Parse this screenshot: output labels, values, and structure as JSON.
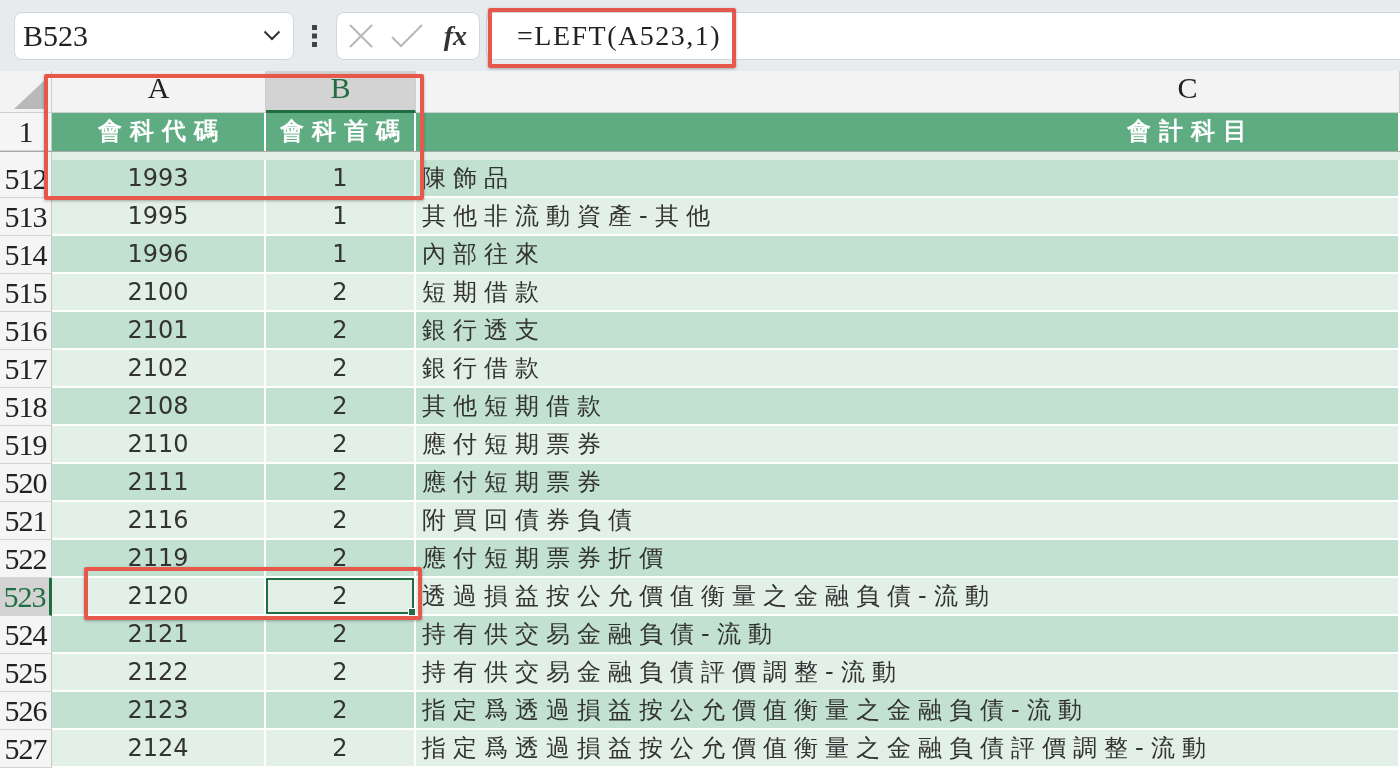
{
  "name_box": {
    "value": "B523"
  },
  "formula_bar": {
    "function_button": "fx",
    "formula": "=LEFT(A523,1)"
  },
  "columns": [
    {
      "letter": "A",
      "selected": false
    },
    {
      "letter": "B",
      "selected": true
    },
    {
      "letter": "C",
      "selected": false
    }
  ],
  "header_row": {
    "number": "1",
    "cells": [
      "會科代碼",
      "會科首碼",
      "會計科目"
    ]
  },
  "rows": [
    {
      "number": "512",
      "selected": false,
      "cells": [
        "1993",
        "1",
        "陳飾品"
      ]
    },
    {
      "number": "513",
      "selected": false,
      "cells": [
        "1995",
        "1",
        "其他非流動資產-其他"
      ]
    },
    {
      "number": "514",
      "selected": false,
      "cells": [
        "1996",
        "1",
        "內部往來"
      ]
    },
    {
      "number": "515",
      "selected": false,
      "cells": [
        "2100",
        "2",
        "短期借款"
      ]
    },
    {
      "number": "516",
      "selected": false,
      "cells": [
        "2101",
        "2",
        "銀行透支"
      ]
    },
    {
      "number": "517",
      "selected": false,
      "cells": [
        "2102",
        "2",
        "銀行借款"
      ]
    },
    {
      "number": "518",
      "selected": false,
      "cells": [
        "2108",
        "2",
        "其他短期借款"
      ]
    },
    {
      "number": "519",
      "selected": false,
      "cells": [
        "2110",
        "2",
        "應付短期票券"
      ]
    },
    {
      "number": "520",
      "selected": false,
      "cells": [
        "2111",
        "2",
        "應付短期票券"
      ]
    },
    {
      "number": "521",
      "selected": false,
      "cells": [
        "2116",
        "2",
        "附買回債券負債"
      ]
    },
    {
      "number": "522",
      "selected": false,
      "cells": [
        "2119",
        "2",
        "應付短期票券折價"
      ]
    },
    {
      "number": "523",
      "selected": true,
      "cells": [
        "2120",
        "2",
        "透過損益按公允價值衡量之金融負債-流動"
      ]
    },
    {
      "number": "524",
      "selected": false,
      "cells": [
        "2121",
        "2",
        "持有供交易金融負債-流動"
      ]
    },
    {
      "number": "525",
      "selected": false,
      "cells": [
        "2122",
        "2",
        "持有供交易金融負債評價調整-流動"
      ]
    },
    {
      "number": "526",
      "selected": false,
      "cells": [
        "2123",
        "2",
        "指定爲透過損益按公允價值衡量之金融負債-流動"
      ]
    },
    {
      "number": "527",
      "selected": false,
      "cells": [
        "2124",
        "2",
        "指定爲透過損益按公允價值衡量之金融負債評價調整-流動"
      ]
    }
  ]
}
